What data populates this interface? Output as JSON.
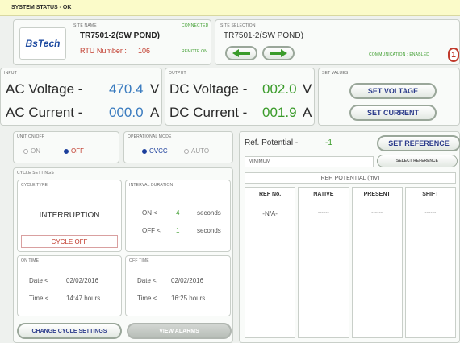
{
  "status_bar": {
    "text": "SYSTEM STATUS - OK"
  },
  "header": {
    "logo": "BsTech",
    "site_name_label": "SITE NAME",
    "connected_label": "CONNECTED",
    "site_name": "TR7501-2(SW POND)",
    "rtu_label": "RTU Number :",
    "rtu_number": "106",
    "remote_label": "REMOTE ON",
    "site_selection_label": "SITE SELECTION",
    "site_selection_value": "TR7501-2(SW POND)",
    "communication_label": "COMMUNICATION : ENABLED",
    "communication_badge": "1"
  },
  "input": {
    "label": "INPUT",
    "ac_voltage_label": "AC Voltage -",
    "ac_voltage_value": "470.4",
    "ac_voltage_unit": "V",
    "ac_current_label": "AC Current -",
    "ac_current_value": "000.0",
    "ac_current_unit": "A"
  },
  "output": {
    "label": "OUTPUT",
    "dc_voltage_label": "DC Voltage -",
    "dc_voltage_value": "002.0",
    "dc_voltage_unit": "V",
    "dc_current_label": "DC Current -",
    "dc_current_value": "001.9",
    "dc_current_unit": "A"
  },
  "set_values": {
    "label": "SET VALUES",
    "set_voltage": "SET VOLTAGE",
    "set_current": "SET CURRENT"
  },
  "unit_on_off": {
    "label": "UNIT ON/OFF",
    "on": "ON",
    "off": "OFF",
    "selected": "OFF"
  },
  "operational_mode": {
    "label": "OPERATIONAL MODE",
    "cvcc": "CVCC",
    "auto": "AUTO",
    "selected": "CVCC"
  },
  "cycle_settings": {
    "label": "CYCLE SETTINGS",
    "cycle_type_label": "CYCLE TYPE",
    "cycle_type": "INTERRUPTION",
    "cycle_status": "CYCLE OFF",
    "interval_label": "INTERVAL DURATION",
    "on_label": "ON <",
    "on_value": "4",
    "off_label": "OFF <",
    "off_value": "1",
    "unit": "seconds",
    "on_time_label": "ON TIME",
    "off_time_label": "OFF TIME",
    "date_label": "Date <",
    "time_label": "Time <",
    "on_date": "02/02/2016",
    "on_time": "14:47 hours",
    "off_date": "02/02/2016",
    "off_time": "16:25 hours"
  },
  "buttons": {
    "change_cycle": "CHANGE CYCLE SETTINGS",
    "view_alarms": "VIEW ALARMS"
  },
  "reference": {
    "label": "Ref. Potential -",
    "value": "-1",
    "set_reference": "SET REFERENCE",
    "select_value": "MINIMUM",
    "select_reference": "SELECT REFERENCE",
    "table_title": "REF. POTENTIAL (mV)",
    "columns": [
      "REF No.",
      "NATIVE",
      "PRESENT",
      "SHIFT"
    ],
    "row": [
      "-N/A-",
      "------",
      "------",
      "------"
    ]
  }
}
